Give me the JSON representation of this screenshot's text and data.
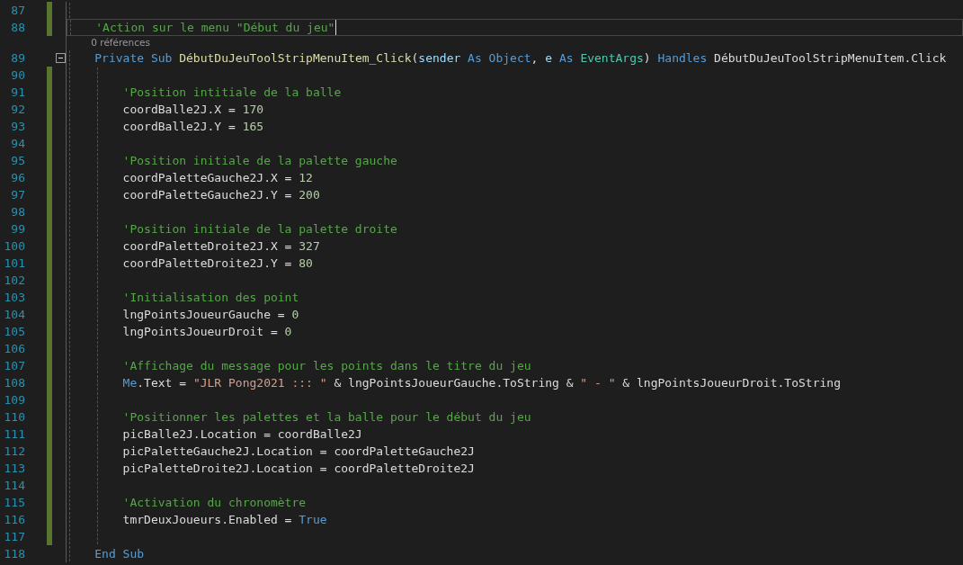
{
  "lines": [
    {
      "number": "87",
      "changed": true,
      "current": false
    },
    {
      "number": "88",
      "changed": true,
      "current": true,
      "tokens": [
        {
          "kind": "comment",
          "text": "'Action sur le menu \"Début du jeu\""
        }
      ]
    },
    {
      "number": "89",
      "changed": false,
      "current": false,
      "codelens": "0 références",
      "expanded": true,
      "tokens": [
        {
          "kind": "keyword",
          "text": "Private Sub "
        },
        {
          "kind": "method",
          "text": "DébutDuJeuToolStripMenuItem_Click"
        },
        {
          "kind": "plain",
          "text": "("
        },
        {
          "kind": "param",
          "text": "sender"
        },
        {
          "kind": "keyword",
          "text": " As Object"
        },
        {
          "kind": "plain",
          "text": ", "
        },
        {
          "kind": "param",
          "text": "e"
        },
        {
          "kind": "keyword",
          "text": " As "
        },
        {
          "kind": "type",
          "text": "EventArgs"
        },
        {
          "kind": "plain",
          "text": ") "
        },
        {
          "kind": "keyword",
          "text": "Handles"
        },
        {
          "kind": "plain",
          "text": " DébutDuJeuToolStripMenuItem.Click"
        }
      ],
      "children": [
        {
          "number": "90",
          "changed": true,
          "current": false
        },
        {
          "number": "91",
          "changed": true,
          "current": false,
          "tokens": [
            {
              "kind": "comment",
              "text": "'Position intitiale de la balle"
            }
          ]
        },
        {
          "number": "92",
          "changed": true,
          "current": false,
          "tokens": [
            {
              "kind": "plain",
              "text": "coordBalle2J.X = "
            },
            {
              "kind": "number",
              "text": "170"
            }
          ]
        },
        {
          "number": "93",
          "changed": true,
          "current": false,
          "tokens": [
            {
              "kind": "plain",
              "text": "coordBalle2J.Y = "
            },
            {
              "kind": "number",
              "text": "165"
            }
          ]
        },
        {
          "number": "94",
          "changed": true,
          "current": false
        },
        {
          "number": "95",
          "changed": true,
          "current": false,
          "tokens": [
            {
              "kind": "comment",
              "text": "'Position initiale de la palette gauche"
            }
          ]
        },
        {
          "number": "96",
          "changed": true,
          "current": false,
          "tokens": [
            {
              "kind": "plain",
              "text": "coordPaletteGauche2J.X = "
            },
            {
              "kind": "number",
              "text": "12"
            }
          ]
        },
        {
          "number": "97",
          "changed": true,
          "current": false,
          "tokens": [
            {
              "kind": "plain",
              "text": "coordPaletteGauche2J.Y = "
            },
            {
              "kind": "number",
              "text": "200"
            }
          ]
        },
        {
          "number": "98",
          "changed": true,
          "current": false
        },
        {
          "number": "99",
          "changed": true,
          "current": false,
          "tokens": [
            {
              "kind": "comment",
              "text": "'Position initiale de la palette droite"
            }
          ]
        },
        {
          "number": "100",
          "changed": true,
          "current": false,
          "tokens": [
            {
              "kind": "plain",
              "text": "coordPaletteDroite2J.X = "
            },
            {
              "kind": "number",
              "text": "327"
            }
          ]
        },
        {
          "number": "101",
          "changed": true,
          "current": false,
          "tokens": [
            {
              "kind": "plain",
              "text": "coordPaletteDroite2J.Y = "
            },
            {
              "kind": "number",
              "text": "80"
            }
          ]
        },
        {
          "number": "102",
          "changed": true,
          "current": false
        },
        {
          "number": "103",
          "changed": true,
          "current": false,
          "tokens": [
            {
              "kind": "comment",
              "text": "'Initialisation des point"
            }
          ]
        },
        {
          "number": "104",
          "changed": true,
          "current": false,
          "tokens": [
            {
              "kind": "plain",
              "text": "lngPointsJoueurGauche = "
            },
            {
              "kind": "number",
              "text": "0"
            }
          ]
        },
        {
          "number": "105",
          "changed": true,
          "current": false,
          "tokens": [
            {
              "kind": "plain",
              "text": "lngPointsJoueurDroit = "
            },
            {
              "kind": "number",
              "text": "0"
            }
          ]
        },
        {
          "number": "106",
          "changed": true,
          "current": false
        },
        {
          "number": "107",
          "changed": true,
          "current": false,
          "tokens": [
            {
              "kind": "comment",
              "text": "'Affichage du message pour les points dans le titre du jeu"
            }
          ]
        },
        {
          "number": "108",
          "changed": true,
          "current": false,
          "tokens": [
            {
              "kind": "keyword",
              "text": "Me"
            },
            {
              "kind": "plain",
              "text": ".Text = "
            },
            {
              "kind": "string",
              "text": "\"JLR Pong2021 ::: \""
            },
            {
              "kind": "plain",
              "text": " & lngPointsJoueurGauche.ToString & "
            },
            {
              "kind": "string",
              "text": "\" - \""
            },
            {
              "kind": "plain",
              "text": " & lngPointsJoueurDroit.ToString"
            }
          ]
        },
        {
          "number": "109",
          "changed": true,
          "current": false
        },
        {
          "number": "110",
          "changed": true,
          "current": false,
          "tokens": [
            {
              "kind": "comment",
              "text": "'Positionner les palettes et la balle pour le début du jeu"
            }
          ]
        },
        {
          "number": "111",
          "changed": true,
          "current": false,
          "tokens": [
            {
              "kind": "plain",
              "text": "picBalle2J.Location = coordBalle2J"
            }
          ]
        },
        {
          "number": "112",
          "changed": true,
          "current": false,
          "tokens": [
            {
              "kind": "plain",
              "text": "picPaletteGauche2J.Location = coordPaletteGauche2J"
            }
          ]
        },
        {
          "number": "113",
          "changed": true,
          "current": false,
          "tokens": [
            {
              "kind": "plain",
              "text": "picPaletteDroite2J.Location = coordPaletteDroite2J"
            }
          ]
        },
        {
          "number": "114",
          "changed": true,
          "current": false
        },
        {
          "number": "115",
          "changed": true,
          "current": false,
          "tokens": [
            {
              "kind": "comment",
              "text": "'Activation du chronomètre"
            }
          ]
        },
        {
          "number": "116",
          "changed": true,
          "current": false,
          "tokens": [
            {
              "kind": "plain",
              "text": "tmrDeuxJoueurs.Enabled = "
            },
            {
              "kind": "keyword",
              "text": "True"
            }
          ]
        },
        {
          "number": "117",
          "changed": true,
          "current": false
        }
      ]
    },
    {
      "number": "118",
      "changed": false,
      "current": false,
      "tokens": [
        {
          "kind": "keyword",
          "text": "End Sub"
        }
      ]
    }
  ]
}
